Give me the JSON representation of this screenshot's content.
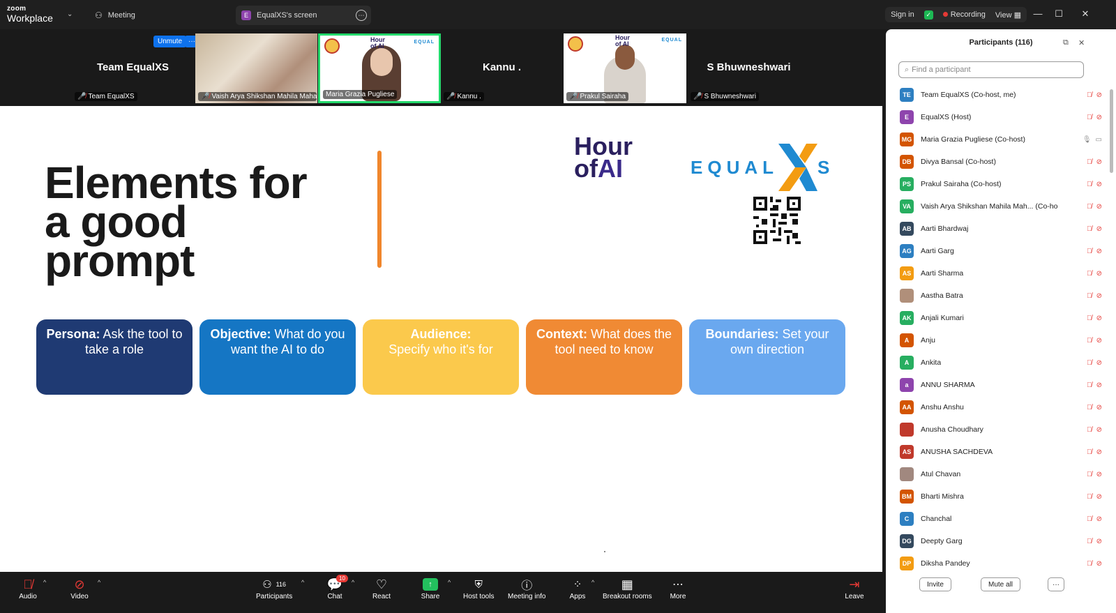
{
  "titlebar": {
    "brand_top": "zoom",
    "brand_bottom": "Workplace",
    "tab_meeting": "Meeting",
    "tab_screen_badge": "E",
    "tab_screen": "EqualXS's screen",
    "sign_in": "Sign in",
    "recording": "Recording",
    "view": "View"
  },
  "videos": {
    "unmute": "Unmute",
    "more": "···",
    "tiles": [
      {
        "name": "Team EqualXS",
        "label": "Team EqualXS"
      },
      {
        "name": "",
        "label": "Vaish Arya Shikshan Mahila Maha..."
      },
      {
        "name": "",
        "label": "Maria Grazia Pugliese"
      },
      {
        "name": "Kannu .",
        "label": "Kannu ."
      },
      {
        "name": "",
        "label": "Prakul Sairaha"
      },
      {
        "name": "S Bhuwneshwari",
        "label": "S Bhuwneshwari"
      }
    ],
    "mini_logo_hour": "Hour",
    "mini_logo_of": "of AI",
    "mini_logo_equal": "EQUAL"
  },
  "slide": {
    "title_l1": "Elements for",
    "title_l2": "a good",
    "title_l3": "prompt",
    "logo_hour": "Hour",
    "logo_of": "of",
    "logo_ai": "AI",
    "logo_equal": "EQUAL",
    "logo_s": "S",
    "cards": [
      {
        "term": "Persona:",
        "text": " Ask the tool to take a role"
      },
      {
        "term": "Objective:",
        "text": " What do you want the AI to do"
      },
      {
        "term": "Audience:",
        "text": "Specify who it's for"
      },
      {
        "term": "Context:",
        "text": " What does the tool need to know"
      },
      {
        "term": "Boundaries:",
        "text": " Set your own direction"
      }
    ]
  },
  "toolbar": {
    "audio": "Audio",
    "video": "Video",
    "participants": "Participants",
    "participants_count": "116",
    "chat": "Chat",
    "chat_badge": "10",
    "react": "React",
    "share": "Share",
    "host_tools": "Host tools",
    "meeting_info": "Meeting info",
    "apps": "Apps",
    "breakout": "Breakout rooms",
    "more": "More",
    "leave": "Leave"
  },
  "panel": {
    "title": "Participants (116)",
    "search_placeholder": "Find a participant",
    "invite": "Invite",
    "mute_all": "Mute all",
    "more": "···",
    "participants": [
      {
        "initials": "TE",
        "name": "Team EqualXS (Co-host, me)",
        "color": "#2d7fc1"
      },
      {
        "initials": "E",
        "name": "EqualXS (Host)",
        "color": "#8e44ad"
      },
      {
        "initials": "MG",
        "name": "Maria Grazia Pugliese (Co-host)",
        "color": "#d35400"
      },
      {
        "initials": "DB",
        "name": "Divya Bansal (Co-host)",
        "color": "#d35400"
      },
      {
        "initials": "PS",
        "name": "Prakul Sairaha (Co-host)",
        "color": "#27ae60"
      },
      {
        "initials": "VA",
        "name": "Vaish Arya Shikshan Mahila Mah... (Co-host)",
        "color": "#27ae60"
      },
      {
        "initials": "AB",
        "name": "Aarti Bhardwaj",
        "color": "#34495e"
      },
      {
        "initials": "AG",
        "name": "Aarti Garg",
        "color": "#2d7fc1"
      },
      {
        "initials": "AS",
        "name": "Aarti Sharma",
        "color": "#f39c12"
      },
      {
        "initials": "",
        "name": "Aastha Batra",
        "color": "#b08f7a"
      },
      {
        "initials": "AK",
        "name": "Anjali Kumari",
        "color": "#27ae60"
      },
      {
        "initials": "A",
        "name": "Anju",
        "color": "#d35400"
      },
      {
        "initials": "A",
        "name": "Ankita",
        "color": "#27ae60"
      },
      {
        "initials": "a",
        "name": "ANNU SHARMA",
        "color": "#8e44ad"
      },
      {
        "initials": "AA",
        "name": "Anshu Anshu",
        "color": "#d35400"
      },
      {
        "initials": "",
        "name": "Anusha Choudhary",
        "color": "#c0392b"
      },
      {
        "initials": "AS",
        "name": "ANUSHA SACHDEVA",
        "color": "#c0392b"
      },
      {
        "initials": "",
        "name": "Atul Chavan",
        "color": "#a1887f"
      },
      {
        "initials": "BM",
        "name": "Bharti Mishra",
        "color": "#d35400"
      },
      {
        "initials": "C",
        "name": "Chanchal",
        "color": "#2d7fc1"
      },
      {
        "initials": "DG",
        "name": "Deepty Garg",
        "color": "#34495e"
      },
      {
        "initials": "DP",
        "name": "Diksha Pandey",
        "color": "#f39c12"
      }
    ]
  },
  "colors": {
    "accent": "#0e72ed",
    "active_speaker": "#23d96b",
    "recording": "#e53935"
  }
}
